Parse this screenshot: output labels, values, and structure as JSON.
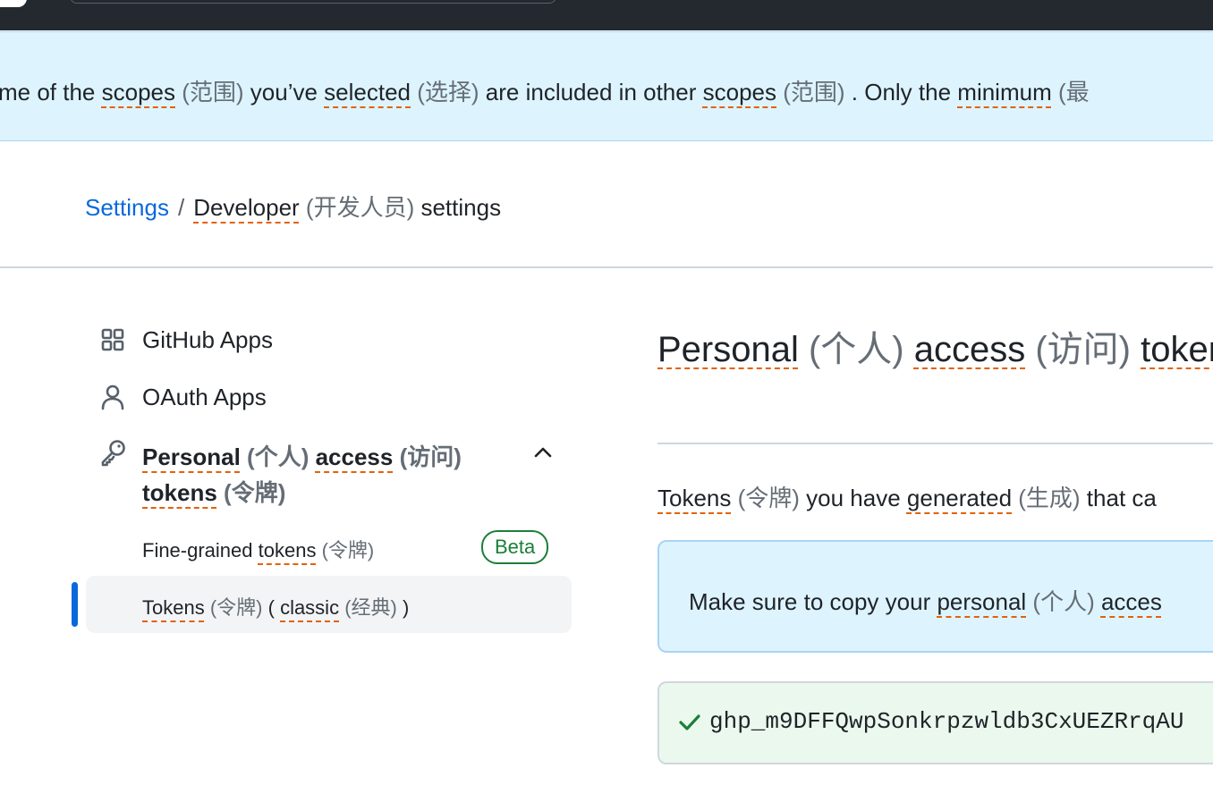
{
  "flash": {
    "p1": "me of the ",
    "w1": "scopes",
    "t1": " (范围)",
    "p2": " you’ve ",
    "w2": "selected",
    "t2": " (选择)",
    "p3": " are included in other ",
    "w3": "scopes",
    "t3": " (范围)",
    "p4": " . Only the ",
    "w4": "minimum",
    "t4": " (最"
  },
  "breadcrumb": {
    "settings": "Settings",
    "separator": "/",
    "developer": "Developer",
    "developer_tr": " (开发人员)",
    "tail": " settings"
  },
  "sidebar": {
    "github_apps": {
      "label": "GitHub Apps",
      "icon": "apps-grid-icon"
    },
    "oauth_apps": {
      "label": "OAuth Apps",
      "icon": "person-icon"
    },
    "pat": {
      "icon": "key-icon",
      "w1": "Personal",
      "t1": " (个人) ",
      "w2": "access",
      "t2": " (访问)",
      "w3": "tokens",
      "t3": " (令牌)"
    },
    "fine_grained": {
      "prefix": "Fine-grained ",
      "w": "tokens",
      "t": " (令牌)",
      "badge": "Beta"
    },
    "classic": {
      "w1": "Tokens",
      "t1": " (令牌) ",
      "p": "( ",
      "w2": "classic",
      "t2": " (经典)",
      "end": " )"
    }
  },
  "main": {
    "title": {
      "w1": "Personal",
      "t1": " (个人) ",
      "w2": "access",
      "t2": " (访问) ",
      "w3": "token"
    },
    "desc": {
      "w1": "Tokens",
      "t1": " (令牌)",
      "p1": " you have ",
      "w2": "generated",
      "t2": " (生成)",
      "p2": " that ca"
    },
    "notice": {
      "p1": "Make sure to copy your ",
      "w1": "personal",
      "t1": " (个人) ",
      "w2": "acces"
    },
    "token": "ghp_m9DFFQwpSonkrpzwldb3CxUEZRrqAU"
  },
  "colors": {
    "link": "#0969da",
    "flash_bg": "#ddf4ff",
    "success": "#1a7f37",
    "underline": "#e36209",
    "topbar": "#24292f"
  }
}
